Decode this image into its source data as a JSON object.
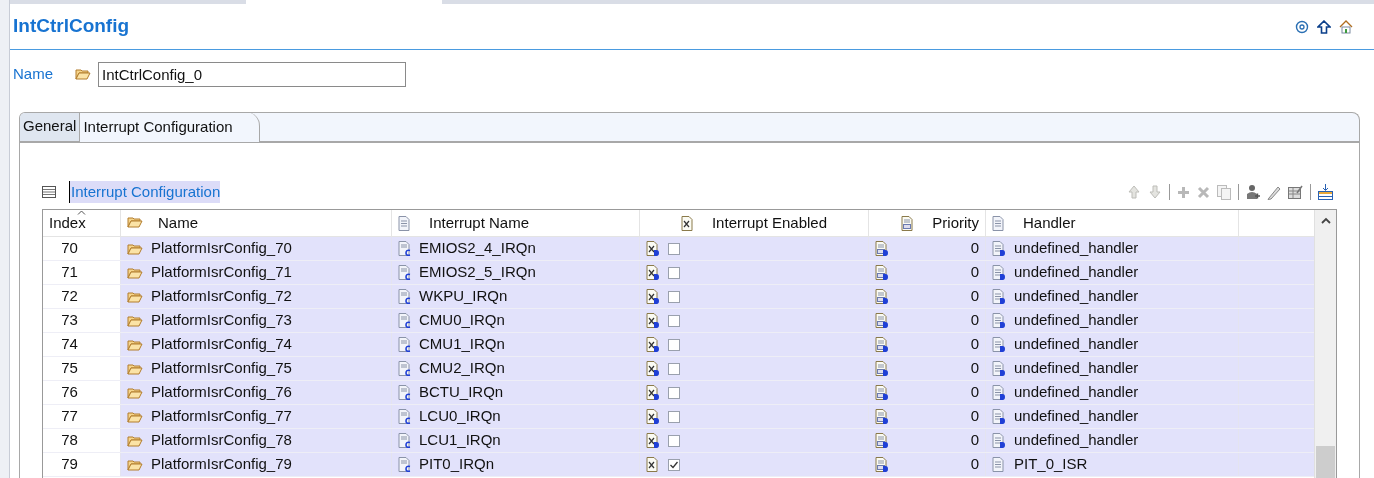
{
  "title": "IntCtrlConfig",
  "name_field": {
    "label": "Name",
    "value": "IntCtrlConfig_0"
  },
  "tabs": [
    {
      "label": "General",
      "selected": false
    },
    {
      "label": "Interrupt Configuration",
      "selected": true
    }
  ],
  "table": {
    "title": "Interrupt Configuration",
    "columns": [
      "Index",
      "Name",
      "Interrupt Name",
      "Interrupt Enabled",
      "Priority",
      "Handler"
    ],
    "rows": [
      {
        "index": "70",
        "name": "PlatformIsrConfig_70",
        "interrupt_name": "EMIOS2_4_IRQn",
        "enabled": false,
        "enabled_default": true,
        "priority": "0",
        "handler": "undefined_handler",
        "handler_default": true
      },
      {
        "index": "71",
        "name": "PlatformIsrConfig_71",
        "interrupt_name": "EMIOS2_5_IRQn",
        "enabled": false,
        "enabled_default": true,
        "priority": "0",
        "handler": "undefined_handler",
        "handler_default": true
      },
      {
        "index": "72",
        "name": "PlatformIsrConfig_72",
        "interrupt_name": "WKPU_IRQn",
        "enabled": false,
        "enabled_default": true,
        "priority": "0",
        "handler": "undefined_handler",
        "handler_default": true
      },
      {
        "index": "73",
        "name": "PlatformIsrConfig_73",
        "interrupt_name": "CMU0_IRQn",
        "enabled": false,
        "enabled_default": true,
        "priority": "0",
        "handler": "undefined_handler",
        "handler_default": true
      },
      {
        "index": "74",
        "name": "PlatformIsrConfig_74",
        "interrupt_name": "CMU1_IRQn",
        "enabled": false,
        "enabled_default": true,
        "priority": "0",
        "handler": "undefined_handler",
        "handler_default": true
      },
      {
        "index": "75",
        "name": "PlatformIsrConfig_75",
        "interrupt_name": "CMU2_IRQn",
        "enabled": false,
        "enabled_default": true,
        "priority": "0",
        "handler": "undefined_handler",
        "handler_default": true
      },
      {
        "index": "76",
        "name": "PlatformIsrConfig_76",
        "interrupt_name": "BCTU_IRQn",
        "enabled": false,
        "enabled_default": true,
        "priority": "0",
        "handler": "undefined_handler",
        "handler_default": true
      },
      {
        "index": "77",
        "name": "PlatformIsrConfig_77",
        "interrupt_name": "LCU0_IRQn",
        "enabled": false,
        "enabled_default": true,
        "priority": "0",
        "handler": "undefined_handler",
        "handler_default": true
      },
      {
        "index": "78",
        "name": "PlatformIsrConfig_78",
        "interrupt_name": "LCU1_IRQn",
        "enabled": false,
        "enabled_default": true,
        "priority": "0",
        "handler": "undefined_handler",
        "handler_default": true
      },
      {
        "index": "79",
        "name": "PlatformIsrConfig_79",
        "interrupt_name": "PIT0_IRQn",
        "enabled": true,
        "enabled_default": false,
        "priority": "0",
        "handler": "PIT_0_ISR",
        "handler_default": false
      }
    ]
  }
}
